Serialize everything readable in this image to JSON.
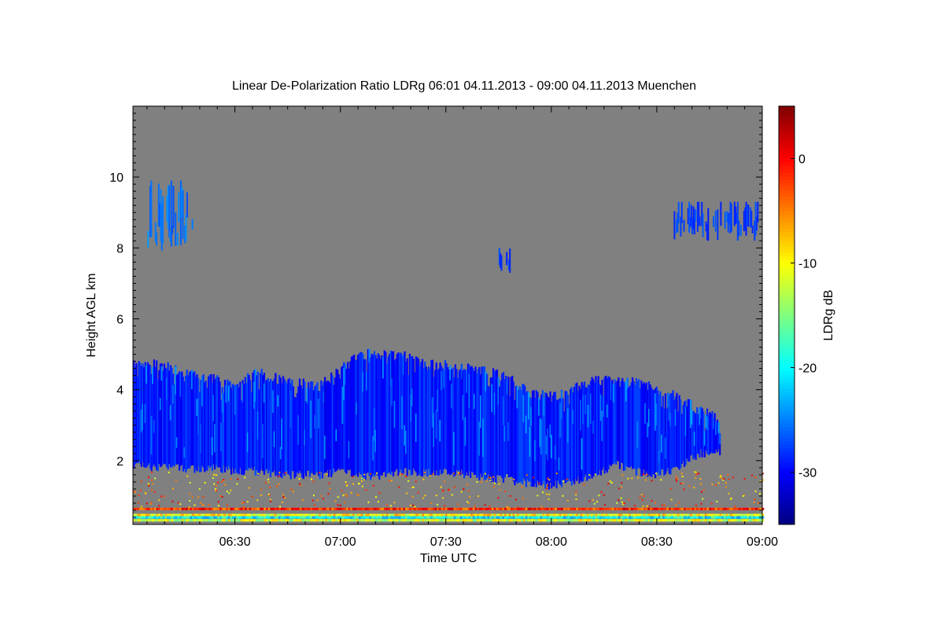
{
  "chart_data": {
    "type": "heatmap",
    "title": "Linear De-Polarization Ratio LDRg   06:01 04.11.2013 - 09:00 04.11.2013 Muenchen",
    "xlabel": "Time UTC",
    "ylabel": "Height AGL km",
    "x_tick_labels": [
      "06:30",
      "07:00",
      "07:30",
      "08:00",
      "08:30",
      "09:00"
    ],
    "x_ticks": [
      6.5,
      7.0,
      7.5,
      8.0,
      8.5,
      9.0
    ],
    "xlim": [
      6.0167,
      9.0
    ],
    "y_ticks": [
      2,
      4,
      6,
      8,
      10
    ],
    "y_tick_labels": [
      "2",
      "4",
      "6",
      "8",
      "10"
    ],
    "ylim": [
      0.2,
      12.0
    ],
    "colorbar": {
      "label": "LDRg dB",
      "ticks": [
        0,
        -10,
        -20,
        -30
      ],
      "tick_labels": [
        "0",
        "-10",
        "-20",
        "-30"
      ],
      "range": [
        -35,
        5
      ]
    },
    "background_color": "#808080",
    "features": {
      "main_cloud": {
        "time_km": [
          [
            6.017,
            1.9,
            4.7
          ],
          [
            6.1,
            1.8,
            4.75
          ],
          [
            6.2,
            1.8,
            4.6
          ],
          [
            6.3,
            1.75,
            4.4
          ],
          [
            6.4,
            1.8,
            4.3
          ],
          [
            6.5,
            1.7,
            4.1
          ],
          [
            6.6,
            1.7,
            4.5
          ],
          [
            6.7,
            1.6,
            4.3
          ],
          [
            6.8,
            1.6,
            4.2
          ],
          [
            6.9,
            1.6,
            4.1
          ],
          [
            7.0,
            1.7,
            4.6
          ],
          [
            7.1,
            1.55,
            5.0
          ],
          [
            7.2,
            1.6,
            5.0
          ],
          [
            7.3,
            1.7,
            4.95
          ],
          [
            7.4,
            1.65,
            4.7
          ],
          [
            7.5,
            1.7,
            4.7
          ],
          [
            7.6,
            1.6,
            4.6
          ],
          [
            7.7,
            1.5,
            4.5
          ],
          [
            7.8,
            1.45,
            4.3
          ],
          [
            7.9,
            1.35,
            3.9
          ],
          [
            8.0,
            1.3,
            3.8
          ],
          [
            8.1,
            1.4,
            4.0
          ],
          [
            8.2,
            1.6,
            4.3
          ],
          [
            8.3,
            1.9,
            4.2
          ],
          [
            8.4,
            1.7,
            4.2
          ],
          [
            8.5,
            1.6,
            4.0
          ],
          [
            8.6,
            1.8,
            3.8
          ],
          [
            8.7,
            2.2,
            3.4
          ],
          [
            8.8,
            2.2,
            3.2
          ]
        ],
        "ldr_db": -30
      },
      "upper_patches": [
        {
          "t_start": 6.08,
          "t_end": 6.3,
          "z_bottom": 7.9,
          "z_top": 9.9,
          "ldr_db": -27
        },
        {
          "t_start": 7.75,
          "t_end": 7.8,
          "z_bottom": 7.1,
          "z_top": 8.0,
          "ldr_db": -29
        },
        {
          "t_start": 8.58,
          "t_end": 8.98,
          "z_bottom": 8.2,
          "z_top": 9.3,
          "ldr_db": -29
        }
      ],
      "near_surface_layers": [
        {
          "z": 0.3,
          "ldr_db": -12
        },
        {
          "z": 0.38,
          "ldr_db": -20
        },
        {
          "z": 0.45,
          "ldr_db": -10
        },
        {
          "z": 0.62,
          "ldr_db": -2
        }
      ]
    }
  }
}
